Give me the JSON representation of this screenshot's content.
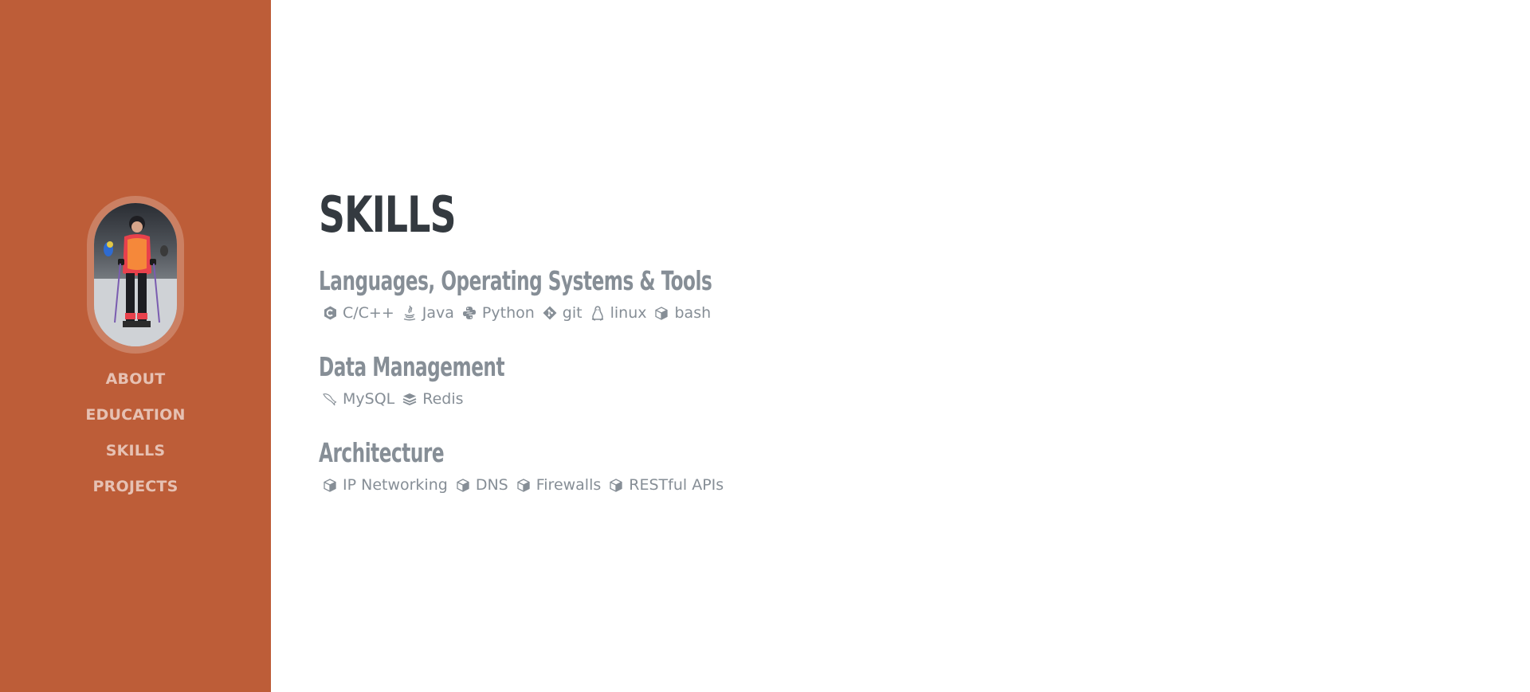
{
  "sidebar": {
    "nav": [
      {
        "label": "ABOUT"
      },
      {
        "label": "EDUCATION"
      },
      {
        "label": "SKILLS"
      },
      {
        "label": "PROJECTS"
      }
    ]
  },
  "main": {
    "title": "SKILLS",
    "sections": [
      {
        "title": "Languages, Operating Systems & Tools",
        "items": [
          {
            "label": "C/C++",
            "icon": "cplusplus-icon"
          },
          {
            "label": "Java",
            "icon": "java-icon"
          },
          {
            "label": "Python",
            "icon": "python-icon"
          },
          {
            "label": "git",
            "icon": "git-icon"
          },
          {
            "label": "linux",
            "icon": "linux-icon"
          },
          {
            "label": "bash",
            "icon": "cube-icon"
          }
        ]
      },
      {
        "title": "Data Management",
        "items": [
          {
            "label": "MySQL",
            "icon": "mysql-icon"
          },
          {
            "label": "Redis",
            "icon": "layers-icon"
          }
        ]
      },
      {
        "title": "Architecture",
        "items": [
          {
            "label": "IP Networking",
            "icon": "cube-icon"
          },
          {
            "label": "DNS",
            "icon": "cube-icon"
          },
          {
            "label": "Firewalls",
            "icon": "cube-icon"
          },
          {
            "label": "RESTful APIs",
            "icon": "cube-icon"
          }
        ]
      }
    ]
  },
  "colors": {
    "sidebar_bg": "#bd5d38",
    "heading": "#343a40",
    "muted": "#868e96"
  }
}
